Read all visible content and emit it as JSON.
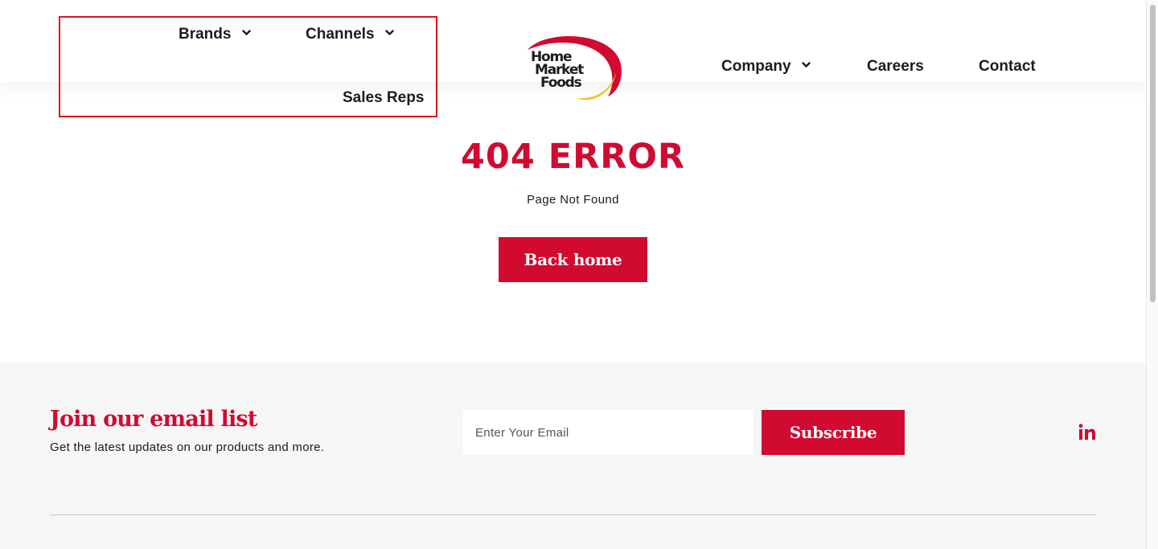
{
  "header": {
    "nav_left": [
      {
        "label": "Brands",
        "has_dropdown": true
      },
      {
        "label": "Channels",
        "has_dropdown": true
      },
      {
        "label": "Sales Reps",
        "has_dropdown": false
      }
    ],
    "logo_text": [
      "Home",
      "Market",
      "Foods"
    ],
    "nav_right": [
      {
        "label": "Company",
        "has_dropdown": true
      },
      {
        "label": "Careers",
        "has_dropdown": false
      },
      {
        "label": "Contact",
        "has_dropdown": false
      }
    ]
  },
  "main": {
    "title": "404 ERROR",
    "subtitle": "Page Not Found",
    "back_button": "Back home"
  },
  "footer": {
    "title": "Join our email list",
    "description": "Get the latest updates on our products and more.",
    "email_placeholder": "Enter Your Email",
    "subscribe_button": "Subscribe",
    "social_icon": "linkedin-icon"
  },
  "colors": {
    "brand_red": "#d10a30",
    "logo_yellow": "#f5c22a",
    "text_dark": "#1c1c1c",
    "footer_bg": "#f6f6f6"
  }
}
